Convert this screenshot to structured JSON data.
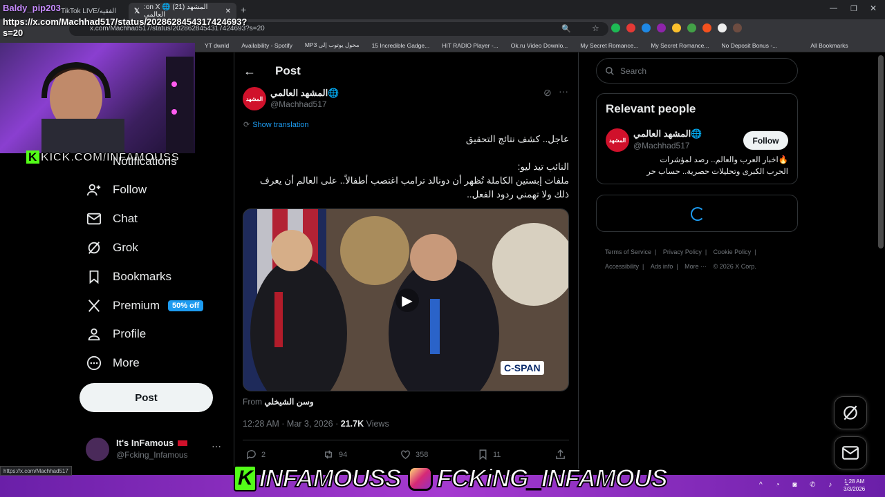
{
  "browser": {
    "tabs": [
      {
        "label": "TikTok LIVE/الفقيه"
      },
      {
        "label": ":on X 🌐 (21) المشهد العالمي"
      }
    ],
    "new_tab": "+",
    "address": "x.com/Machhad517/status/2028628454317424693?s=20",
    "bookmarks": [
      "YT dwnld",
      "Availability - Spotify",
      "MP3 محول يوتوب إلى",
      "15 Incredible Gadge...",
      "HIT RADIO Player -...",
      "Ok.ru Video Downlo...",
      "My Secret Romance...",
      "My Secret Romance...",
      "No Deposit Bonus -..."
    ],
    "all_bookmarks": "All Bookmarks"
  },
  "overlay": {
    "title": "Baldy_pip203",
    "url": "https://x.com/Machhad517/status/2028628454317424693?s=20",
    "kick": "KICK.COM/INFAMOUSS",
    "banner_kick": "INFAMOUSS",
    "banner_ig": "FCKiNG_INFAMOUS"
  },
  "nav": {
    "notifications": "Notifications",
    "follow": "Follow",
    "chat": "Chat",
    "grok": "Grok",
    "bookmarks": "Bookmarks",
    "premium": "Premium",
    "premium_badge": "50% off",
    "profile": "Profile",
    "more": "More",
    "post": "Post"
  },
  "account": {
    "name": "It's InFamous",
    "handle": "@Fcking_Infamous",
    "more": "···"
  },
  "post": {
    "header": "Post",
    "author_name": "المشهد العالمي",
    "author_handle": "@Machhad517",
    "show_translation": "Show translation",
    "text_line1": "عاجل.. كشف نتائج التحقيق",
    "text_line2": "النائب تيد ليو:",
    "text_line3": "ملفات إبستين الكاملة تُظهر أن دونالد ترامب اغتصب أطفالاً.. على العالم أن يعرف",
    "text_line4": "ذلك ولا تهمني ردود الفعل..",
    "video_badge": "C-SPAN",
    "from_label": "From",
    "from_name": "وسن الشيخلي",
    "time": "12:28 AM · Mar 3, 2026 ·",
    "views_count": "21.7K",
    "views_label": "Views",
    "replies": "2",
    "reposts": "94",
    "likes": "358",
    "bookmarks": "11"
  },
  "sidebar": {
    "search_placeholder": "Search",
    "relevant_title": "Relevant people",
    "person_name": "المشهد العالمي",
    "person_handle": "@Machhad517",
    "follow_button": "Follow",
    "bio_line1": "🔥اخبار العرب والعالم.. رصد لمؤشرات",
    "bio_line2": "الحرب الكبرى وتحليلات حصرية.. حساب حر",
    "footer": [
      "Terms of Service",
      "Privacy Policy",
      "Cookie Policy",
      "Accessibility",
      "Ads info",
      "More ···",
      "© 2026 X Corp."
    ]
  },
  "status_bar_url": "https://x.com/Machhad517",
  "taskbar": {
    "time": "1:28 AM",
    "date": "3/3/2026"
  },
  "colors": {
    "accent": "#1d9bf0",
    "kick_green": "#53fc18",
    "avatar_red": "#d0112b"
  }
}
